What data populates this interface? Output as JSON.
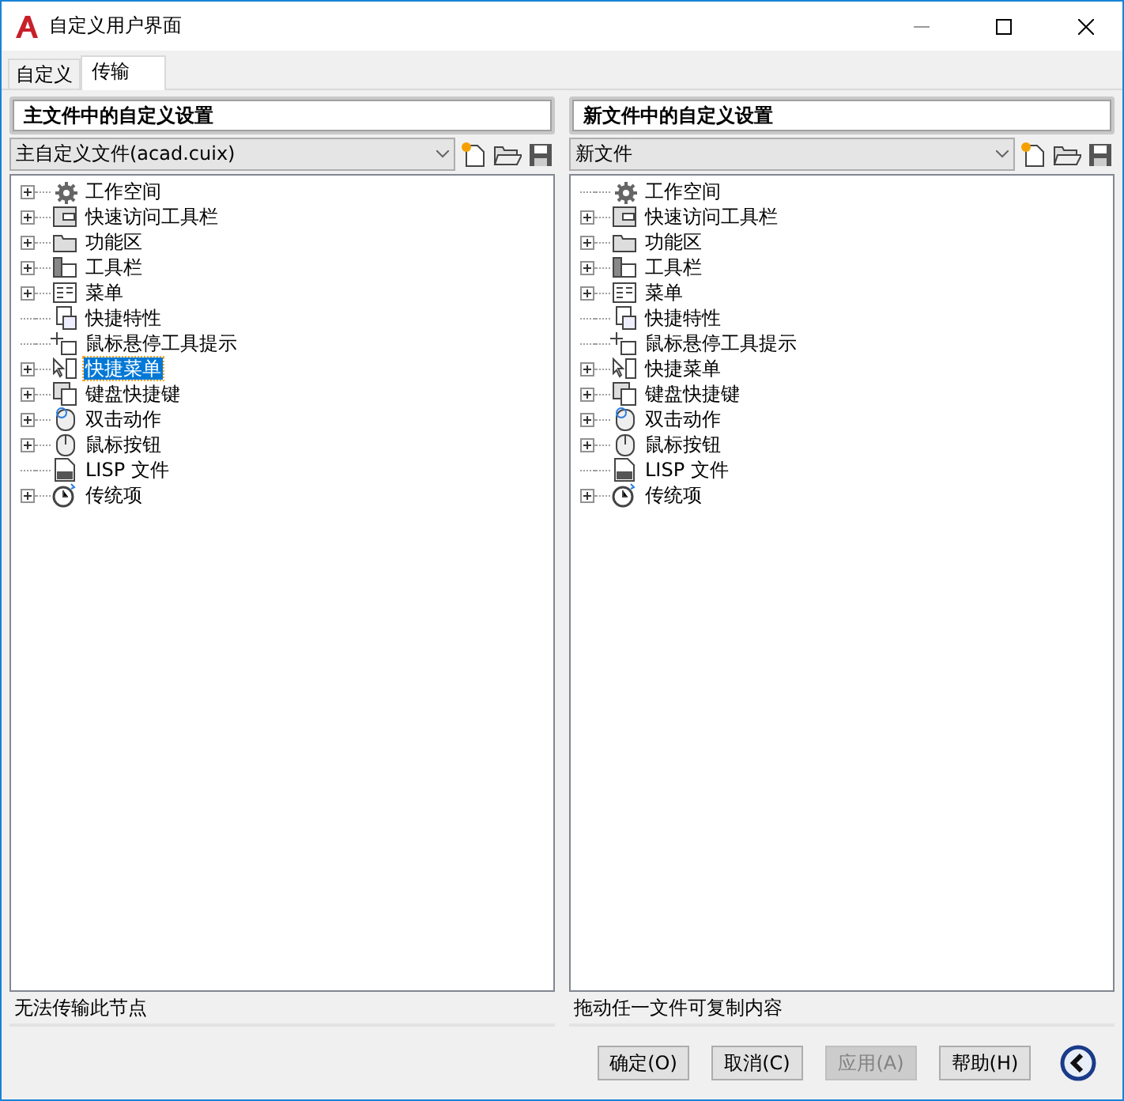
{
  "window": {
    "title": "自定义用户界面"
  },
  "tabs": [
    {
      "label": "自定义",
      "selected": false
    },
    {
      "label": "传输",
      "selected": true
    }
  ],
  "panels": [
    {
      "header": "主文件中的自定义设置",
      "file": "主自定义文件(acad.cuix)",
      "status": "无法传输此节点",
      "items": [
        {
          "label": "工作空间",
          "kind": "workspace",
          "expandable": true,
          "selected": false
        },
        {
          "label": "快速访问工具栏",
          "kind": "quickbar",
          "expandable": true,
          "selected": false
        },
        {
          "label": "功能区",
          "kind": "ribbon",
          "expandable": true,
          "selected": false
        },
        {
          "label": "工具栏",
          "kind": "toolbar",
          "expandable": true,
          "selected": false
        },
        {
          "label": "菜单",
          "kind": "menu",
          "expandable": true,
          "selected": false
        },
        {
          "label": "快捷特性",
          "kind": "props",
          "expandable": false,
          "selected": false
        },
        {
          "label": "鼠标悬停工具提示",
          "kind": "tooltip",
          "expandable": false,
          "selected": false
        },
        {
          "label": "快捷菜单",
          "kind": "shortcut",
          "expandable": true,
          "selected": true
        },
        {
          "label": "键盘快捷键",
          "kind": "keyboard",
          "expandable": true,
          "selected": false
        },
        {
          "label": "双击动作",
          "kind": "dblclick",
          "expandable": true,
          "selected": false
        },
        {
          "label": "鼠标按钮",
          "kind": "mouse",
          "expandable": true,
          "selected": false
        },
        {
          "label": "LISP 文件",
          "kind": "lisp",
          "expandable": false,
          "selected": false
        },
        {
          "label": "传统项",
          "kind": "legacy",
          "expandable": true,
          "selected": false
        }
      ]
    },
    {
      "header": "新文件中的自定义设置",
      "file": "新文件",
      "status": "拖动任一文件可复制内容",
      "items": [
        {
          "label": "工作空间",
          "kind": "workspace",
          "expandable": false,
          "selected": false
        },
        {
          "label": "快速访问工具栏",
          "kind": "quickbar",
          "expandable": true,
          "selected": false
        },
        {
          "label": "功能区",
          "kind": "ribbon",
          "expandable": true,
          "selected": false
        },
        {
          "label": "工具栏",
          "kind": "toolbar",
          "expandable": true,
          "selected": false
        },
        {
          "label": "菜单",
          "kind": "menu",
          "expandable": true,
          "selected": false
        },
        {
          "label": "快捷特性",
          "kind": "props",
          "expandable": false,
          "selected": false
        },
        {
          "label": "鼠标悬停工具提示",
          "kind": "tooltip",
          "expandable": false,
          "selected": false
        },
        {
          "label": "快捷菜单",
          "kind": "shortcut",
          "expandable": true,
          "selected": false
        },
        {
          "label": "键盘快捷键",
          "kind": "keyboard",
          "expandable": true,
          "selected": false
        },
        {
          "label": "双击动作",
          "kind": "dblclick",
          "expandable": true,
          "selected": false
        },
        {
          "label": "鼠标按钮",
          "kind": "mouse",
          "expandable": true,
          "selected": false
        },
        {
          "label": "LISP 文件",
          "kind": "lisp",
          "expandable": false,
          "selected": false
        },
        {
          "label": "传统项",
          "kind": "legacy",
          "expandable": true,
          "selected": false
        }
      ]
    }
  ],
  "buttons": [
    {
      "label": "确定(O)",
      "disabled": false
    },
    {
      "label": "取消(C)",
      "disabled": false
    },
    {
      "label": "应用(A)",
      "disabled": true
    },
    {
      "label": "帮助(H)",
      "disabled": false
    }
  ]
}
